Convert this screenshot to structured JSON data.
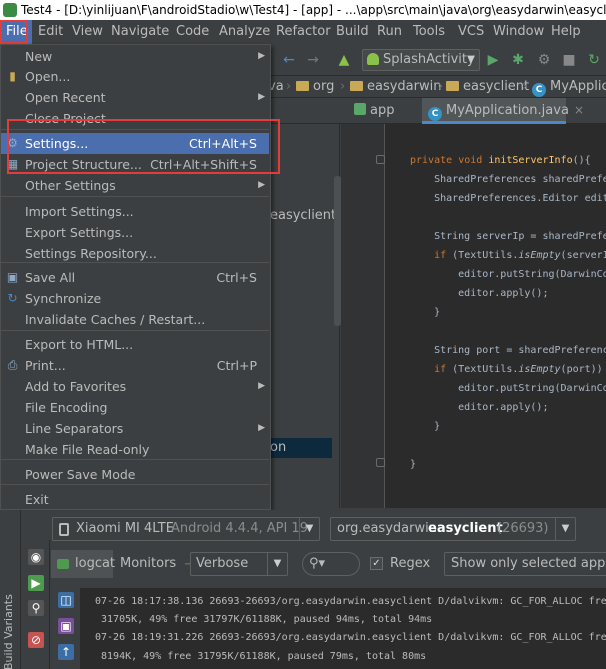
{
  "window": {
    "title": "Test4 - [D:\\yinlijuan\\F\\androidStadio\\w\\Test4] - [app] - ...\\app\\src\\main\\java\\org\\easydarwin\\easyclient"
  },
  "menubar": [
    "File",
    "Edit",
    "View",
    "Navigate",
    "Code",
    "Analyze",
    "Refactor",
    "Build",
    "Run",
    "Tools",
    "VCS",
    "Window",
    "Help"
  ],
  "toolbar": {
    "run_config": "SplashActivity"
  },
  "breadcrumbs": [
    "va",
    "org",
    "easydarwin",
    "easyclient",
    "MyApplica"
  ],
  "editor_tabs": [
    "app",
    "MyApplication.java"
  ],
  "project_panel": {
    "item_label": "easyclient",
    "selected_label": "on"
  },
  "file_menu": {
    "items": [
      {
        "label": "New",
        "shortcut": "",
        "submenu": true
      },
      {
        "label": "Open...",
        "shortcut": "",
        "submenu": false
      },
      {
        "label": "Open Recent",
        "shortcut": "",
        "submenu": true
      },
      {
        "label": "Close Project",
        "shortcut": "",
        "submenu": false
      },
      {
        "label": "Settings...",
        "shortcut": "Ctrl+Alt+S",
        "submenu": false
      },
      {
        "label": "Project Structure...",
        "shortcut": "Ctrl+Alt+Shift+S",
        "submenu": false
      },
      {
        "label": "Other Settings",
        "shortcut": "",
        "submenu": true
      },
      {
        "label": "Import Settings...",
        "shortcut": "",
        "submenu": false
      },
      {
        "label": "Export Settings...",
        "shortcut": "",
        "submenu": false
      },
      {
        "label": "Settings Repository...",
        "shortcut": "",
        "submenu": false
      },
      {
        "label": "Save All",
        "shortcut": "Ctrl+S",
        "submenu": false
      },
      {
        "label": "Synchronize",
        "shortcut": "",
        "submenu": false
      },
      {
        "label": "Invalidate Caches / Restart...",
        "shortcut": "",
        "submenu": false
      },
      {
        "label": "Export to HTML...",
        "shortcut": "",
        "submenu": false
      },
      {
        "label": "Print...",
        "shortcut": "Ctrl+P",
        "submenu": false
      },
      {
        "label": "Add to Favorites",
        "shortcut": "",
        "submenu": true
      },
      {
        "label": "File Encoding",
        "shortcut": "",
        "submenu": false
      },
      {
        "label": "Line Separators",
        "shortcut": "",
        "submenu": true
      },
      {
        "label": "Make File Read-only",
        "shortcut": "",
        "submenu": false
      },
      {
        "label": "Power Save Mode",
        "shortcut": "",
        "submenu": false
      },
      {
        "label": "Exit",
        "shortcut": "",
        "submenu": false
      }
    ],
    "highlighted_index": 4
  },
  "code_lines": [
    {
      "text": "private void initServerInfo(){"
    },
    {
      "text": "    SharedPreferences sharedPrefe"
    },
    {
      "text": "    SharedPreferences.Editor edit"
    },
    {
      "text": ""
    },
    {
      "text": "    String serverIp = sharedPrefe"
    },
    {
      "text": "    if (TextUtils.isEmpty(serverI"
    },
    {
      "text": "        editor.putString(DarwinCo"
    },
    {
      "text": "        editor.apply();"
    },
    {
      "text": "    }"
    },
    {
      "text": ""
    },
    {
      "text": "    String port = sharedPreferenc"
    },
    {
      "text": "    if (TextUtils.isEmpty(port))"
    },
    {
      "text": "        editor.putString(DarwinCo"
    },
    {
      "text": "        editor.apply();"
    },
    {
      "text": "    }"
    },
    {
      "text": ""
    },
    {
      "text": "}"
    }
  ],
  "logcat": {
    "device_name": "Xiaomi MI 4LTE",
    "device_detail": "Android 4.4.4, API 19",
    "process_prefix": "org.easydarwin.",
    "process_bold": "easyclient",
    "process_pid": "(26693)",
    "tab_logcat": "logcat",
    "tab_monitors": "Monitors",
    "log_level": "Verbose",
    "regex_label": "Regex",
    "filter_scope": "Show only selected applica",
    "side_label": "Build Variants",
    "lines": [
      "07-26 18:17:38.136 26693-26693/org.easydarwin.easyclient D/dalvikvm: GC_FOR_ALLOC fre",
      " 31705K, 49% free 31797K/61188K, paused 94ms, total 94ms",
      "07-26 18:19:31.226 26693-26693/org.easydarwin.easyclient D/dalvikvm: GC_FOR_ALLOC fre",
      " 8194K, 49% free 31795K/61188K, paused 79ms, total 80ms"
    ]
  },
  "colors": {
    "menu_highlight": "#4b6eaf",
    "annotation_red": "#e53b3b",
    "background": "#3c3f41",
    "editor_bg": "#2b2b2b"
  }
}
